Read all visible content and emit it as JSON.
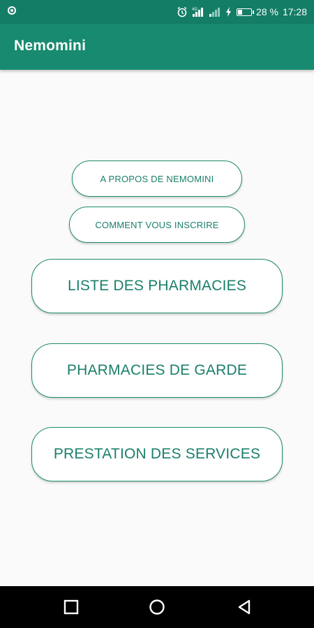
{
  "status_bar": {
    "battery_percent": "28 %",
    "time": "17:28",
    "icons": [
      "notification-dot-icon",
      "alarm-icon",
      "signal-icon",
      "signal-weak-icon",
      "charging-icon",
      "battery-icon"
    ],
    "battery_level": 0.28
  },
  "app_bar": {
    "title": "Nemomini",
    "color": "#178a70"
  },
  "menu": {
    "about_label": "A PROPOS DE NEMOMINI",
    "register_label": "COMMENT VOUS INSCRIRE",
    "pharmacies_label": "LISTE DES PHARMACIES",
    "on_duty_label": "PHARMACIES DE GARDE",
    "services_label": "PRESTATION DES SERVICES",
    "accent_color": "#1a7f6a"
  },
  "nav_bar": {
    "icons": [
      "recent-apps-icon",
      "home-icon",
      "back-icon"
    ]
  }
}
